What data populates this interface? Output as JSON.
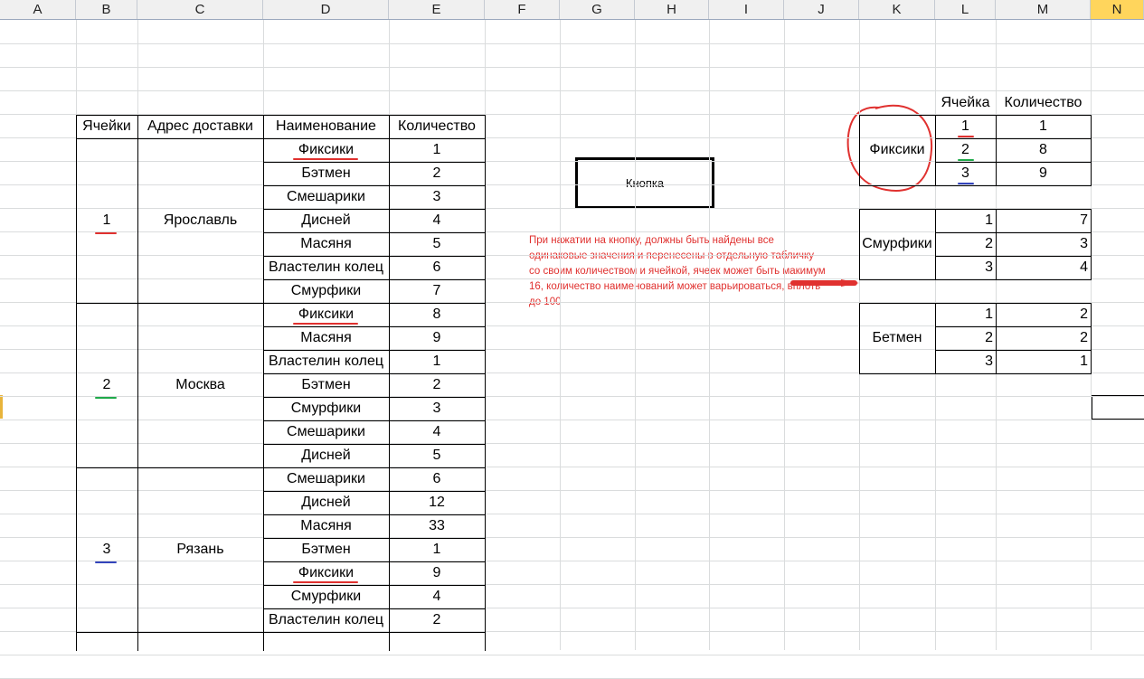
{
  "columns": [
    "A",
    "B",
    "C",
    "D",
    "E",
    "F",
    "G",
    "H",
    "I",
    "J",
    "K",
    "L",
    "M",
    "N"
  ],
  "selected_column": "N",
  "main_table": {
    "headers": [
      "Ячейки",
      "Адрес доставки",
      "Наименование",
      "Количество"
    ],
    "groups": [
      {
        "cell": "1",
        "address": "Ярославль",
        "rows": [
          [
            "Фиксики",
            "1"
          ],
          [
            "Бэтмен",
            "2"
          ],
          [
            "Смешарики",
            "3"
          ],
          [
            "Дисней",
            "4"
          ],
          [
            "Масяня",
            "5"
          ],
          [
            "Властелин колец",
            "6"
          ],
          [
            "Смурфики",
            "7"
          ]
        ]
      },
      {
        "cell": "2",
        "address": "Москва",
        "rows": [
          [
            "Фиксики",
            "8"
          ],
          [
            "Масяня",
            "9"
          ],
          [
            "Властелин колец",
            "1"
          ],
          [
            "Бэтмен",
            "2"
          ],
          [
            "Смурфики",
            "3"
          ],
          [
            "Смешарики",
            "4"
          ],
          [
            "Дисней",
            "5"
          ]
        ]
      },
      {
        "cell": "3",
        "address": "Рязань",
        "rows": [
          [
            "Смешарики",
            "6"
          ],
          [
            "Дисней",
            "12"
          ],
          [
            "Масяня",
            "33"
          ],
          [
            "Бэтмен",
            "1"
          ],
          [
            "Фиксики",
            "9"
          ],
          [
            "Смурфики",
            "4"
          ],
          [
            "Властелин колец",
            "2"
          ]
        ]
      }
    ]
  },
  "button": {
    "label": "Кнопка"
  },
  "note": "При нажатии на кнопку, должны быть найдены все одинаковые значения и перенесены в отдельную табличку со своим количеством и ячейкой, ячеек может быть макимум 16, количество наименований может варьироваться, вплоть до 100",
  "summary": {
    "headers": [
      "Ячейка",
      "Количество"
    ],
    "tables": [
      {
        "name": "Фиксики",
        "rows": [
          [
            "1",
            "1"
          ],
          [
            "2",
            "8"
          ],
          [
            "3",
            "9"
          ]
        ]
      },
      {
        "name": "Смурфики",
        "rows": [
          [
            "1",
            "7"
          ],
          [
            "2",
            "3"
          ],
          [
            "3",
            "4"
          ]
        ]
      },
      {
        "name": "Бетмен",
        "rows": [
          [
            "1",
            "2"
          ],
          [
            "2",
            "2"
          ],
          [
            "3",
            "1"
          ]
        ]
      }
    ]
  },
  "colors": {
    "red": "#e0312f",
    "green": "#1faa4a",
    "blue": "#3344bb",
    "selected_header": "#ffd55c"
  }
}
